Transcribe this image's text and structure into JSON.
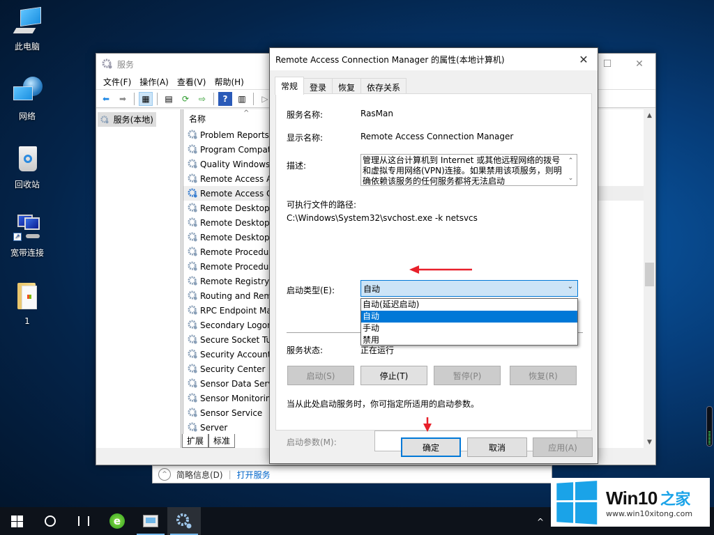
{
  "desktop": {
    "icons": [
      {
        "label": "此电脑",
        "icon": "computer-icon"
      },
      {
        "label": "网络",
        "icon": "network-icon"
      },
      {
        "label": "回收站",
        "icon": "recycle-bin-icon"
      },
      {
        "label": "宽带连接",
        "icon": "broadband-connection-icon"
      },
      {
        "label": "1",
        "icon": "folder-icon"
      }
    ]
  },
  "services_window": {
    "title": "服务",
    "menu": [
      "文件(F)",
      "操作(A)",
      "查看(V)",
      "帮助(H)"
    ],
    "tree_item": "服务(本地)",
    "column_header": "名称",
    "rows": [
      "Problem Reports",
      "Program Compat",
      "Quality Windows",
      "Remote Access A",
      "Remote Access C",
      "Remote Desktop",
      "Remote Desktop",
      "Remote Desktop",
      "Remote Procedur",
      "Remote Procedur",
      "Remote Registry",
      "Routing and Rem",
      "RPC Endpoint Ma",
      "Secondary Logon",
      "Secure Socket Tu",
      "Security Accounts",
      "Security Center",
      "Sensor Data Serv",
      "Sensor Monitorin",
      "Sensor Service",
      "Server"
    ],
    "selected_row_index": 4,
    "bottom_tabs": [
      "扩展",
      "标准"
    ],
    "info_bar": {
      "toggle": "简略信息(D)",
      "link": "打开服务"
    }
  },
  "dialog": {
    "title": "Remote Access Connection Manager 的属性(本地计算机)",
    "tabs": [
      "常规",
      "登录",
      "恢复",
      "依存关系"
    ],
    "active_tab": "常规",
    "service_name_label": "服务名称:",
    "service_name": "RasMan",
    "display_name_label": "显示名称:",
    "display_name": "Remote Access Connection Manager",
    "description_label": "描述:",
    "description": "管理从这台计算机到 Internet 或其他远程网络的拨号和虚拟专用网络(VPN)连接。如果禁用该项服务，则明确依赖该服务的任何服务都将无法启动",
    "path_label": "可执行文件的路径:",
    "path": "C:\\Windows\\System32\\svchost.exe -k netsvcs",
    "startup_type_label": "启动类型(E):",
    "startup_type_value": "自动",
    "startup_options": [
      "自动(延迟启动)",
      "自动",
      "手动",
      "禁用"
    ],
    "highlighted_option": "自动",
    "status_label": "服务状态:",
    "status_value": "正在运行",
    "service_buttons": {
      "start": "启动(S)",
      "stop": "停止(T)",
      "pause": "暂停(P)",
      "resume": "恢复(R)"
    },
    "hint": "当从此处启动服务时，你可指定所适用的启动参数。",
    "params_label": "启动参数(M):",
    "params_value": "",
    "ok": "确定",
    "cancel": "取消",
    "apply": "应用(A)"
  },
  "watermark": {
    "title": "Win10",
    "title_cn": "之家",
    "url": "www.win10xitong.com"
  },
  "colors": {
    "accent": "#0078d7",
    "annotation_arrow": "#e8202a",
    "watermark_blue": "#1aa3e8"
  }
}
